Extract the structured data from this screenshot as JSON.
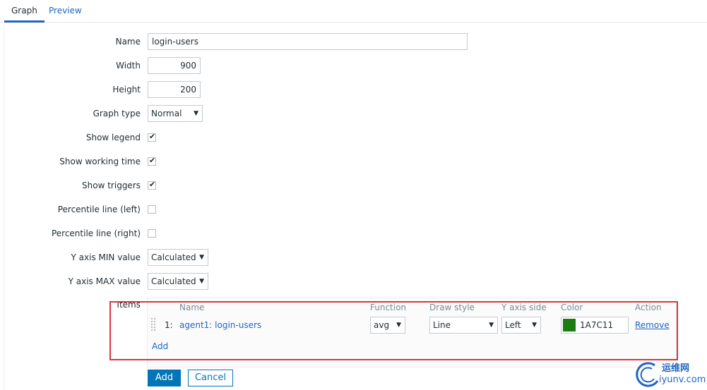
{
  "tabs": [
    {
      "label": "Graph",
      "active": true
    },
    {
      "label": "Preview",
      "active": false
    }
  ],
  "form": {
    "name": {
      "label": "Name",
      "value": "login-users"
    },
    "width": {
      "label": "Width",
      "value": "900"
    },
    "height": {
      "label": "Height",
      "value": "200"
    },
    "graph_type": {
      "label": "Graph type",
      "value": "Normal"
    },
    "show_legend": {
      "label": "Show legend",
      "checked": true
    },
    "show_working_time": {
      "label": "Show working time",
      "checked": true
    },
    "show_triggers": {
      "label": "Show triggers",
      "checked": true
    },
    "percentile_left": {
      "label": "Percentile line (left)",
      "checked": false
    },
    "percentile_right": {
      "label": "Percentile line (right)",
      "checked": false
    },
    "y_min": {
      "label": "Y axis MIN value",
      "value": "Calculated"
    },
    "y_max": {
      "label": "Y axis MAX value",
      "value": "Calculated"
    }
  },
  "items": {
    "label": "Items",
    "headers": {
      "name": "Name",
      "function": "Function",
      "draw_style": "Draw style",
      "y_axis_side": "Y axis side",
      "color": "Color",
      "action": "Action"
    },
    "rows": [
      {
        "number": "1:",
        "name": "agent1: login-users",
        "function": "avg",
        "draw_style": "Line",
        "y_axis_side": "Left",
        "color_hex": "1A7C11",
        "color_swatch": "#1a7c11",
        "action": "Remove"
      }
    ],
    "add_link": "Add"
  },
  "buttons": {
    "add": "Add",
    "cancel": "Cancel"
  },
  "watermark": {
    "cn": "运维网",
    "en": "iyunv.com"
  },
  "colors": {
    "accent": "#0275b8",
    "link": "#1f65c2",
    "highlight": "#d9363e"
  }
}
